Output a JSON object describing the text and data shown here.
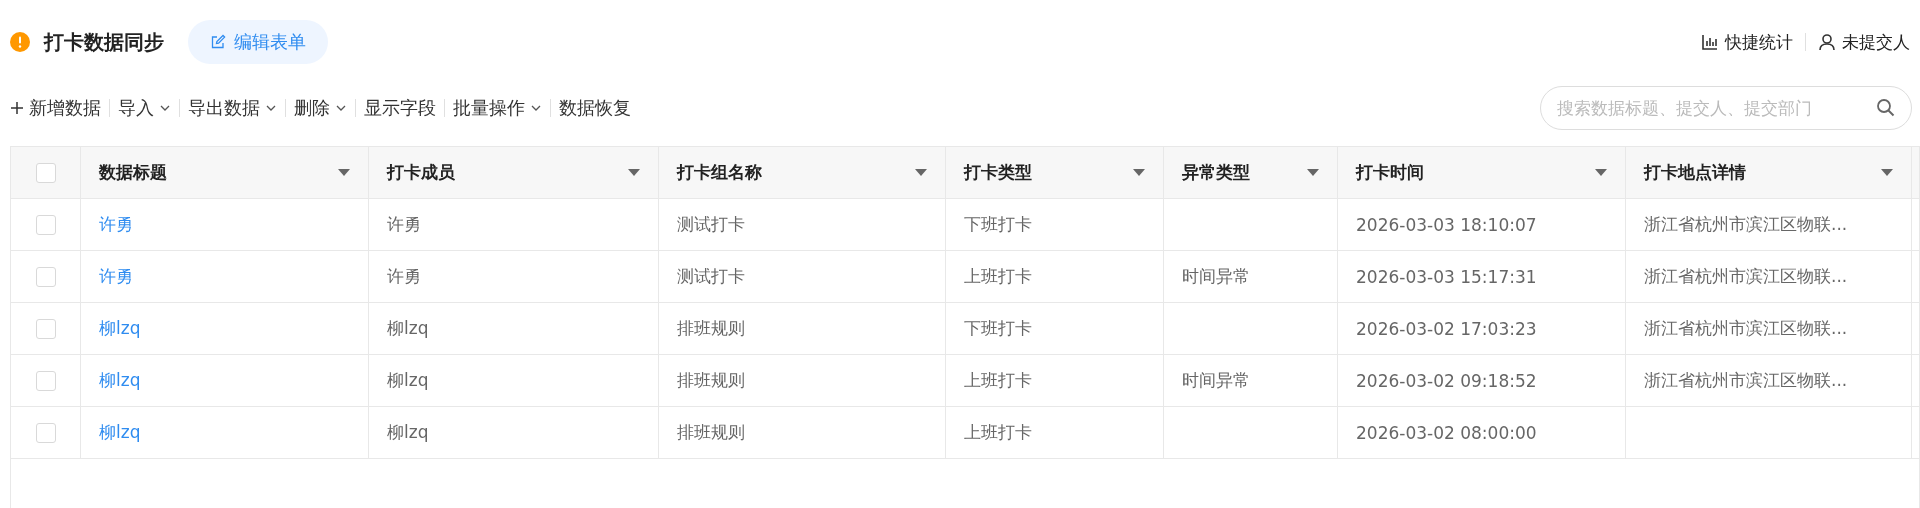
{
  "header": {
    "title": "打卡数据同步",
    "edit_button": "编辑表单",
    "actions": [
      {
        "kind": "stats",
        "label": "快捷统计"
      },
      {
        "kind": "person",
        "label": "未提交人"
      }
    ]
  },
  "toolbar": [
    {
      "kind": "add",
      "label": "新增数据"
    },
    {
      "kind": "menu",
      "label": "导入"
    },
    {
      "kind": "menu",
      "label": "导出数据"
    },
    {
      "kind": "menu",
      "label": "删除"
    },
    {
      "kind": "plain",
      "label": "显示字段"
    },
    {
      "kind": "menu",
      "label": "批量操作"
    },
    {
      "kind": "plain",
      "label": "数据恢复"
    }
  ],
  "search": {
    "placeholder": "搜索数据标题、提交人、提交部门"
  },
  "table": {
    "all_checked": false,
    "columns": [
      "数据标题",
      "打卡成员",
      "打卡组名称",
      "打卡类型",
      "异常类型",
      "打卡时间",
      "打卡地点详情"
    ],
    "rows": [
      {
        "checked": false,
        "cells": [
          "许勇",
          "许勇",
          "测试打卡",
          "下班打卡",
          "",
          "2026-03-03 18:10:07",
          "浙江省杭州市滨江区物联..."
        ]
      },
      {
        "checked": false,
        "cells": [
          "许勇",
          "许勇",
          "测试打卡",
          "上班打卡",
          "时间异常",
          "2026-03-03 15:17:31",
          "浙江省杭州市滨江区物联..."
        ]
      },
      {
        "checked": false,
        "cells": [
          "柳lzq",
          "柳lzq",
          "排班规则",
          "下班打卡",
          "",
          "2026-03-02 17:03:23",
          "浙江省杭州市滨江区物联..."
        ]
      },
      {
        "checked": false,
        "cells": [
          "柳lzq",
          "柳lzq",
          "排班规则",
          "上班打卡",
          "时间异常",
          "2026-03-02 09:18:52",
          "浙江省杭州市滨江区物联..."
        ]
      },
      {
        "checked": false,
        "cells": [
          "柳lzq",
          "柳lzq",
          "排班规则",
          "上班打卡",
          "",
          "2026-03-02 08:00:00",
          ""
        ]
      }
    ]
  }
}
